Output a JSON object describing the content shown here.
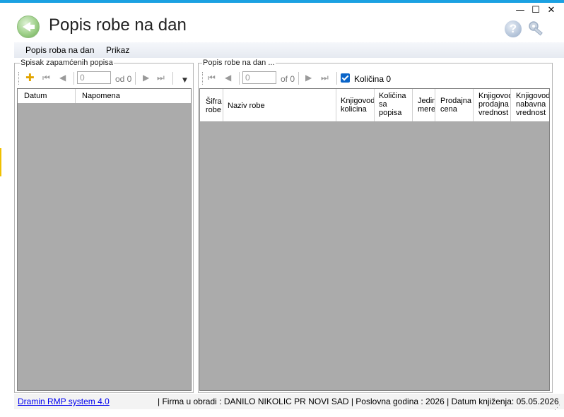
{
  "window": {
    "title": "Popis robe na dan",
    "controls": {
      "minimize": "—",
      "maximize": "☐",
      "close": "✕"
    }
  },
  "menu": {
    "items": [
      "Popis roba na dan",
      "Prikaz"
    ]
  },
  "left_panel": {
    "label": "Spisak zapamćenih popisa",
    "nav": {
      "position": "0",
      "count_text": "od 0"
    },
    "columns": [
      "Datum",
      "Napomena"
    ]
  },
  "right_panel": {
    "label": "Popis robe na dan ...",
    "nav": {
      "position": "0",
      "count_text": "of 0"
    },
    "checkbox": {
      "label": "Količina 0",
      "checked": true
    },
    "columns": [
      "Šifra robe",
      "Naziv robe",
      "Knjigovod kolicina",
      "Količina sa popisa",
      "Jedin mere",
      "Prodajna cena",
      "Knjigovod prodajna vrednost",
      "Knjigovod nabavna vrednost"
    ]
  },
  "status": {
    "link": "Dramin RMP system 4.0",
    "text": "|  Firma u obradi : DANILO NIKOLIC PR NOVI SAD  |  Poslovna godina : 2026  |  Datum knjiženja: 05.05.2026"
  },
  "colors": {
    "accent": "#1ba1e2",
    "grid_bg": "#ababab",
    "checkbox": "#0a64c8"
  }
}
